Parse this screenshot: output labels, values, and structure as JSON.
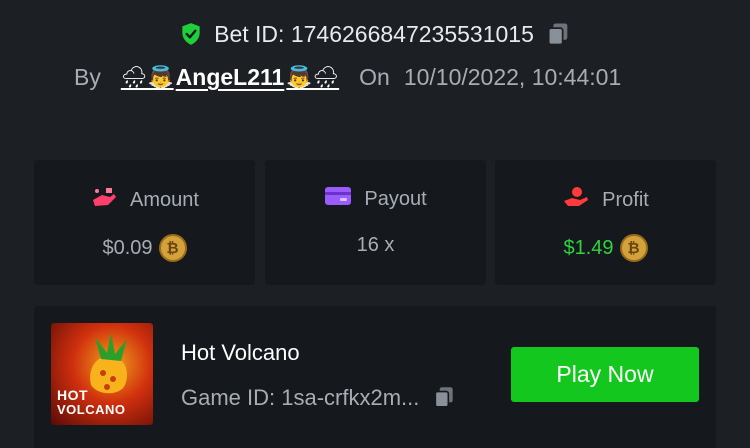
{
  "header": {
    "bet_id": "Bet ID: 1746266847235531015",
    "by_label": "By",
    "user_prefix_emoji": "🌧👼",
    "username": "AngeL211",
    "user_suffix_emoji": "👼🌧",
    "on_label": "On",
    "datetime": "10/10/2022, 10:44:01"
  },
  "stats": [
    {
      "label": "Amount",
      "value": "$0.09",
      "icon": "money-hand-icon",
      "icon_color": "#ff3f6b"
    },
    {
      "label": "Payout",
      "value": "16 x",
      "icon": "card-icon",
      "icon_color": "#9b5cff"
    },
    {
      "label": "Profit",
      "value": "$1.49",
      "icon": "profit-hand-icon",
      "icon_color": "#ff3b3b",
      "value_color": "#2fd43f"
    }
  ],
  "game": {
    "name": "Hot Volcano",
    "game_id": "Game ID: 1sa-crfkx2m...",
    "thumb_line1": "HOT",
    "thumb_line2": "VOLCANO",
    "play_label": "Play Now"
  },
  "colors": {
    "background": "#1c1f24",
    "card": "#15181c",
    "accent_green": "#14c71f",
    "shield_green": "#1fcf3a",
    "muted_text": "#a7adb5"
  }
}
